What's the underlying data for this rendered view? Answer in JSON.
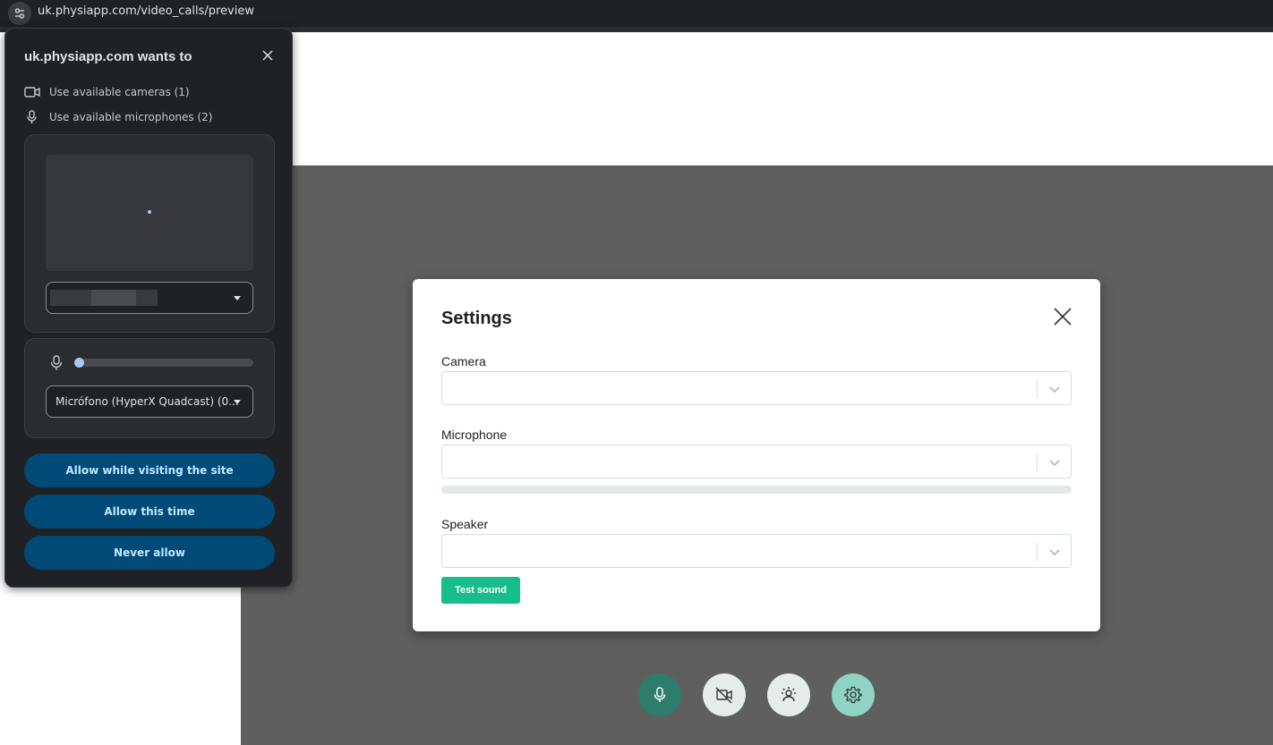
{
  "browser": {
    "url": "uk.physiapp.com/video_calls/preview",
    "site_info_icon": "tune-icon"
  },
  "settings_modal": {
    "title": "Settings",
    "camera_label": "Camera",
    "camera_value": "",
    "microphone_label": "Microphone",
    "microphone_value": "",
    "microphone_level": 0,
    "speaker_label": "Speaker",
    "speaker_value": "",
    "test_sound_label": "Test sound"
  },
  "controls": [
    {
      "name": "microphone",
      "icon": "microphone-icon",
      "color": "#2e7d6b"
    },
    {
      "name": "camera-off",
      "icon": "video-off-icon",
      "color": "#e6ece9"
    },
    {
      "name": "background-effects",
      "icon": "person-effects-icon",
      "color": "#e6ece9"
    },
    {
      "name": "settings",
      "icon": "gear-icon",
      "color": "#8fd4c3"
    }
  ],
  "permission_popup": {
    "title": "uk.physiapp.com wants to",
    "camera_permission": "Use available cameras (1)",
    "microphone_permission": "Use available microphones (2)",
    "camera_select_value": "",
    "microphone_select_value": "Micrófono (HyperX Quadcast) (0...",
    "microphone_level": 0,
    "allow_site_label": "Allow while visiting the site",
    "allow_once_label": "Allow this time",
    "never_allow_label": "Never allow"
  },
  "colors": {
    "accent": "#17bd8a",
    "popup_button": "#004a77",
    "video_bg": "#5f5f5f"
  }
}
